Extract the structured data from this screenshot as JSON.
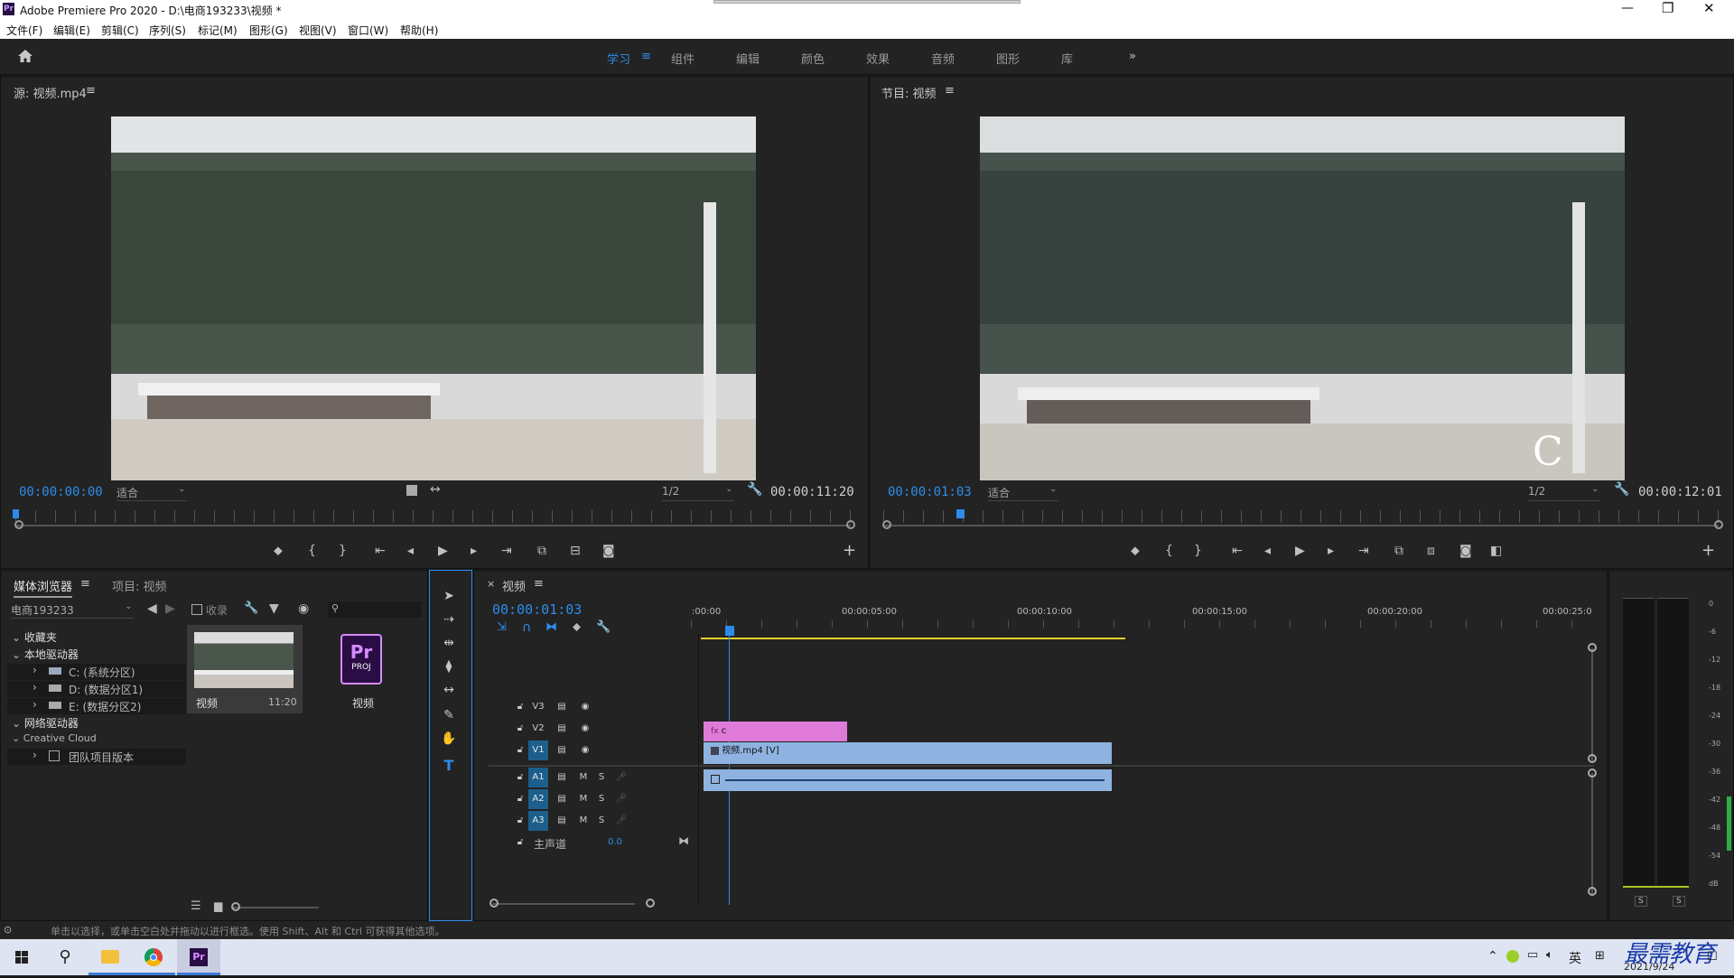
{
  "window": {
    "title": "Adobe Premiere Pro 2020 - D:\\电商193233\\视频 *",
    "logo": "Pr"
  },
  "menu": [
    "文件(F)",
    "编辑(E)",
    "剪辑(C)",
    "序列(S)",
    "标记(M)",
    "图形(G)",
    "视图(V)",
    "窗口(W)",
    "帮助(H)"
  ],
  "workspaces": {
    "active": "学习",
    "items": [
      "组件",
      "编辑",
      "颜色",
      "效果",
      "音频",
      "图形",
      "库"
    ],
    "more": "»"
  },
  "source": {
    "title": "源: 视频.mp4",
    "timecode": "00:00:00:00",
    "fit": "适合",
    "res": "1/2",
    "duration": "00:00:11:20"
  },
  "program": {
    "title": "节目: 视频",
    "timecode": "00:00:01:03",
    "fit": "适合",
    "res": "1/2",
    "duration": "00:00:12:01",
    "overlay_text": "C"
  },
  "media_browser": {
    "tab": "媒体浏览器",
    "tab2": "项目: 视频",
    "location": "电商193233",
    "ingest": "收录",
    "tree": {
      "favorites": "收藏夹",
      "local": "本地驱动器",
      "drives": [
        "C: (系统分区)",
        "D: (数据分区1)",
        "E: (数据分区2)"
      ],
      "network": "网络驱动器",
      "cc": "Creative Cloud",
      "team": "团队项目版本"
    },
    "items": [
      {
        "name": "视频",
        "duration": "11:20"
      },
      {
        "name": "视频",
        "badge": "Pr",
        "sub": "PROJ"
      }
    ]
  },
  "timeline": {
    "tab": "视频",
    "timecode": "00:00:01:03",
    "ruler": [
      ":00:00",
      "00:00:05:00",
      "00:00:10:00",
      "00:00:15:00",
      "00:00:20:00",
      "00:00:25:0"
    ],
    "video_tracks": [
      "V3",
      "V2",
      "V1"
    ],
    "audio_tracks": [
      "A1",
      "A2",
      "A3"
    ],
    "master": {
      "label": "主声道",
      "value": "0.0"
    },
    "clips": {
      "v2": "c",
      "v1": "视频.mp4 [V]"
    }
  },
  "meter": {
    "scale": [
      "0",
      "-6",
      "-12",
      "-18",
      "-24",
      "-30",
      "-36",
      "-42",
      "-48",
      "-54",
      "dB"
    ],
    "solo": [
      "S",
      "S"
    ]
  },
  "status": "单击以选择，或单击空白处并拖动以进行框选。使用 Shift、Alt 和 Ctrl 可获得其他选项。",
  "taskbar": {
    "ime": "英",
    "date": "2021/9/24",
    "watermark": "最需教育"
  },
  "colors": {
    "accent": "#2d8ceb",
    "clip_video": "#8fb3e0",
    "clip_graphic": "#e07ad8",
    "workarea": "#e2d12a"
  }
}
